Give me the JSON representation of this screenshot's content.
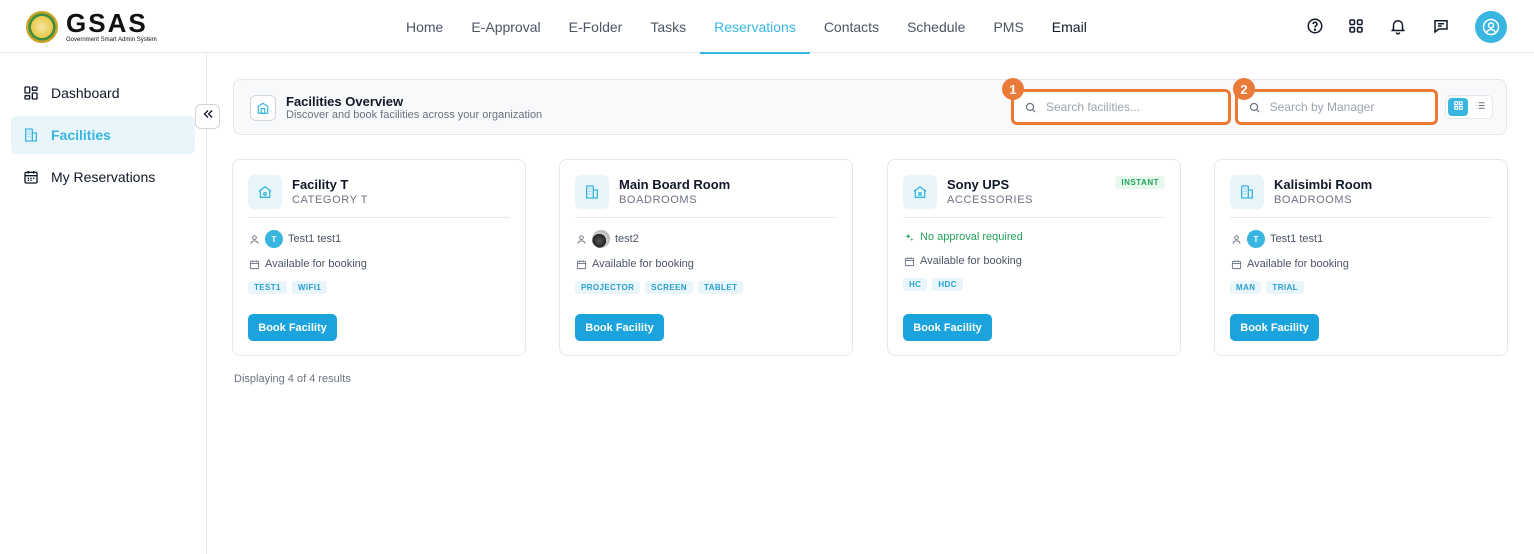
{
  "header": {
    "brand": "GSAS",
    "brand_sub": "Government Smart Admin System",
    "nav": [
      {
        "label": "Home",
        "active": false
      },
      {
        "label": "E-Approval",
        "active": false
      },
      {
        "label": "E-Folder",
        "active": false
      },
      {
        "label": "Tasks",
        "active": false
      },
      {
        "label": "Reservations",
        "active": true
      },
      {
        "label": "Contacts",
        "active": false
      },
      {
        "label": "Schedule",
        "active": false
      },
      {
        "label": "PMS",
        "active": false
      },
      {
        "label": "Email",
        "active": false
      }
    ],
    "icons": [
      "help-icon",
      "apps-grid-icon",
      "bell-icon",
      "chat-icon",
      "user-avatar-icon"
    ]
  },
  "sidebar": {
    "items": [
      {
        "label": "Dashboard",
        "icon": "dashboard-icon",
        "active": false
      },
      {
        "label": "Facilities",
        "icon": "building-icon",
        "active": true
      },
      {
        "label": "My Reservations",
        "icon": "calendar-icon",
        "active": false
      }
    ],
    "collapse_icon": "chevrons-left-icon"
  },
  "overview": {
    "title": "Facilities Overview",
    "subtitle": "Discover and book facilities across your organization",
    "search_facilities": {
      "placeholder": "Search facilities...",
      "value": "",
      "marker": "1"
    },
    "search_manager": {
      "placeholder": "Search by Manager",
      "value": "",
      "marker": "2"
    },
    "view_modes": [
      "grid",
      "list"
    ],
    "active_view": "grid"
  },
  "facilities": [
    {
      "name": "Facility T",
      "category": "CATEGORY T",
      "icon": "house-icon",
      "manager": "Test1 test1",
      "manager_initial": "T",
      "availability": "Available for booking",
      "tags": [
        "TEST1",
        "WIFI1"
      ],
      "button": "Book Facility"
    },
    {
      "name": "Main Board Room",
      "category": "BOADROOMS",
      "icon": "building-icon",
      "manager": "test2",
      "manager_initial": "",
      "availability": "Available for booking",
      "tags": [
        "PROJECTOR",
        "SCREEN",
        "TABLET"
      ],
      "button": "Book Facility"
    },
    {
      "name": "Sony UPS",
      "category": "ACCESSORIES",
      "icon": "house-icon",
      "badge": "INSTANT",
      "approval": "No approval required",
      "availability": "Available for booking",
      "tags": [
        "HC",
        "HDC"
      ],
      "button": "Book Facility"
    },
    {
      "name": "Kalisimbi Room",
      "category": "BOADROOMS",
      "icon": "building-icon",
      "manager": "Test1 test1",
      "manager_initial": "T",
      "availability": "Available for booking",
      "tags": [
        "MAN",
        "TRIAL"
      ],
      "button": "Book Facility"
    }
  ],
  "results_text": "Displaying 4 of 4 results",
  "colors": {
    "accent": "#38b6e0",
    "button": "#1aa3dd",
    "highlight": "#ea7a3a",
    "success": "#22a35a"
  }
}
